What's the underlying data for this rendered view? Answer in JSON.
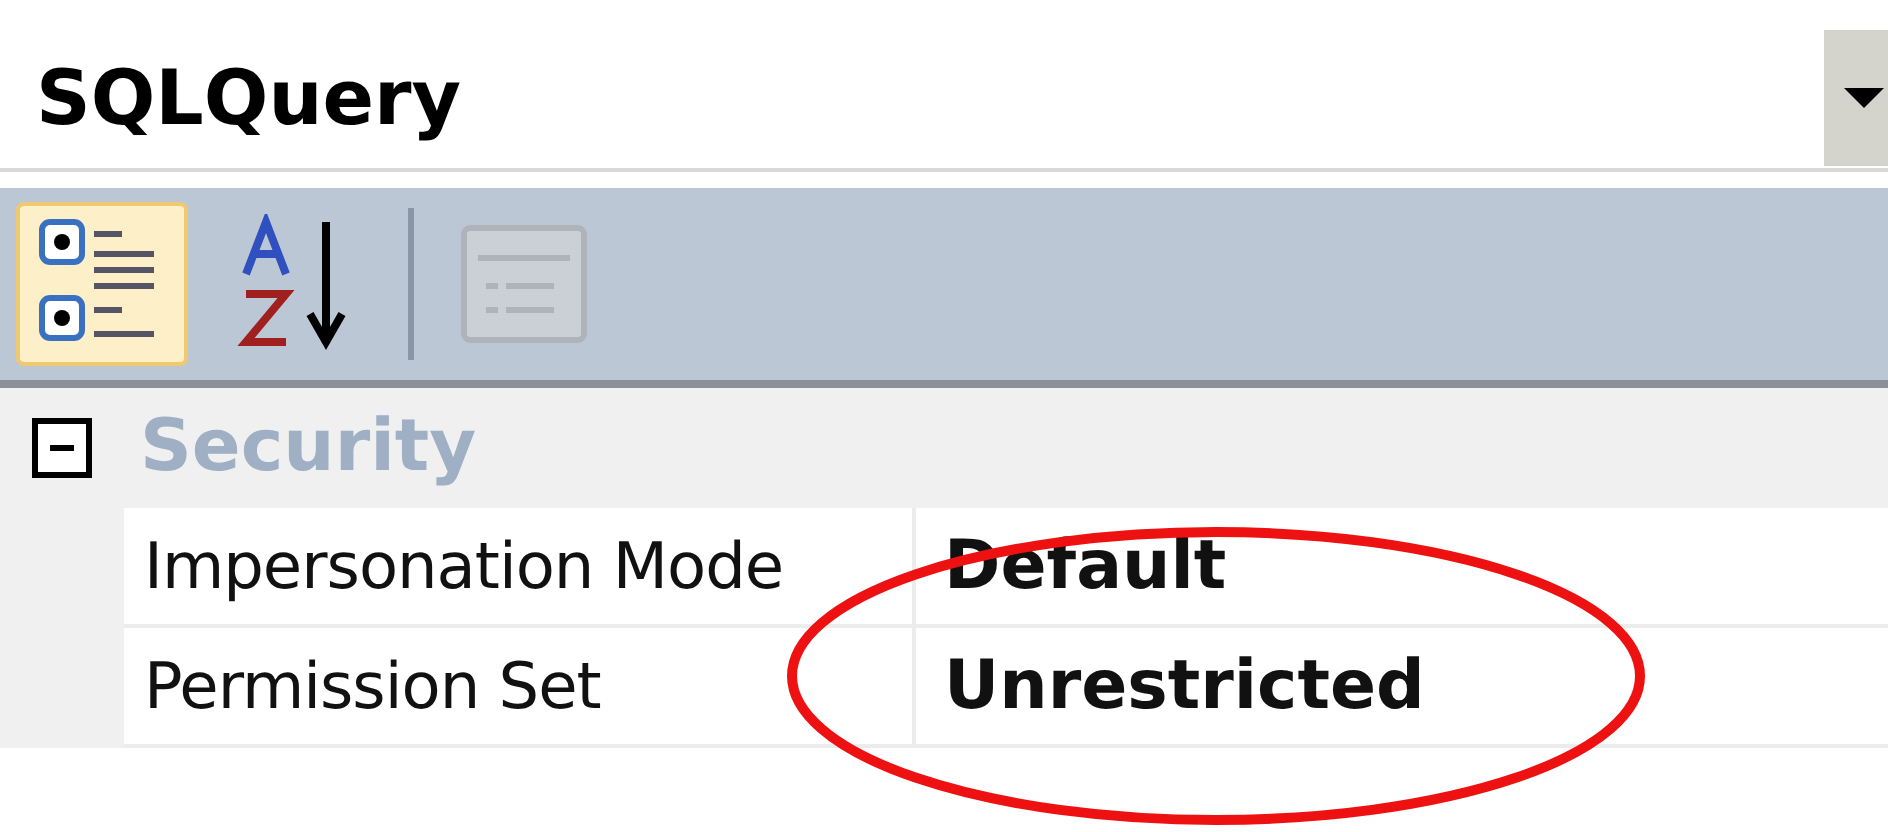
{
  "object_selector": {
    "value": "SQLQuery"
  },
  "toolbar": [
    {
      "kind": "categorized",
      "selected": true
    },
    {
      "kind": "alphabetical",
      "selected": false
    },
    {
      "kind": "separator"
    },
    {
      "kind": "property_pages",
      "selected": false,
      "disabled": true
    }
  ],
  "categories": [
    {
      "name": "Security",
      "expanded": true,
      "properties": [
        {
          "name": "Impersonation Mode",
          "value": "Default"
        },
        {
          "name": "Permission Set",
          "value": "Unrestricted"
        }
      ]
    }
  ]
}
